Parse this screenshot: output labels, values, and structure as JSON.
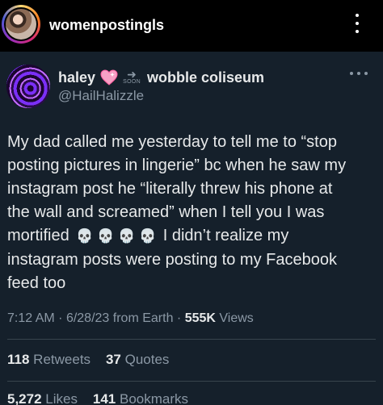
{
  "instagram": {
    "username": "womenpostingls"
  },
  "tweet": {
    "display_name": "haley",
    "emoji_heart": "💗",
    "soon_label": "SOON",
    "linked_name": "wobble coliseum",
    "handle": "@HailHalizzle",
    "text_lines": [
      "My dad called me yesterday to tell me to “stop",
      "posting pictures in lingerie” bc when he saw my",
      "instagram post he “literally threw his phone at",
      "the wall and screamed” when I tell you I was",
      "mortified",
      "I didn’t realize my",
      "instagram posts were posting to my Facebook",
      "feed too"
    ],
    "skull_emoji": "💀",
    "time": "7:12 AM",
    "date": "6/28/23",
    "source": "from Earth",
    "views_count": "555K",
    "views_label": "Views",
    "retweets_count": "118",
    "retweets_label": "Retweets",
    "quotes_count": "37",
    "quotes_label": "Quotes",
    "likes_count": "5,272",
    "likes_label": "Likes",
    "bookmarks_count": "141",
    "bookmarks_label": "Bookmarks"
  },
  "colors": {
    "tweet_bg": "#15202b",
    "text_primary": "#e7e9ea",
    "text_secondary": "#8b98a5",
    "divider": "#38444d",
    "heart": "#f7a0c5"
  },
  "icons": {
    "header_more": "vertical-ellipsis",
    "tweet_more": "horizontal-ellipsis",
    "heart": "sparkling-heart",
    "soon_arrow": "arrow-right"
  }
}
